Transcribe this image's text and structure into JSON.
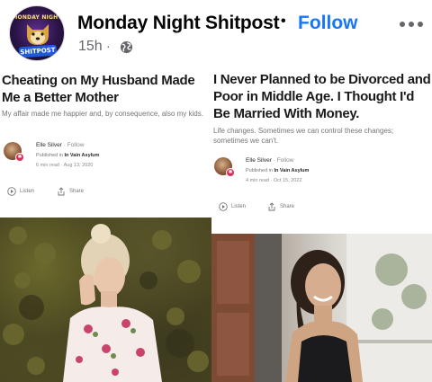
{
  "post": {
    "page_name": "Monday Night Shitpost",
    "separator": "•",
    "follow_label": "Follow",
    "time": "15h",
    "time_separator": "·",
    "privacy_icon": "globe-icon",
    "more_icon": "more-dots-icon"
  },
  "page_avatar": {
    "top_text": "MONDAY NIGHT",
    "badge_text": "SHITPOST",
    "accent": "#1f59d6"
  },
  "articles": [
    {
      "title": "Cheating on My Husband Made Me a Better Mother",
      "subtitle": "My affair made me happier and, by consequence, also my kids.",
      "author": "Elle Silver",
      "author_follow": "Follow",
      "published_prefix": "Published in",
      "publication": "In Vain Asylum",
      "read_time": "6 min read",
      "date": "Aug 13, 2020",
      "listen_label": "Listen",
      "share_label": "Share"
    },
    {
      "title": "I Never Planned to be Divorced and Poor in Middle Age. I Thought I'd Be Married With Money.",
      "subtitle": "Life changes. Sometimes we can control these changes; sometimes we can't.",
      "author": "Elle Silver",
      "author_follow": "Follow",
      "published_prefix": "Published in",
      "publication": "In Vain Asylum",
      "read_time": "4 min read",
      "date": "Oct 15, 2022",
      "listen_label": "Listen",
      "share_label": "Share"
    }
  ],
  "colors": {
    "follow_blue": "#1877f2",
    "meta_gray": "#65676b",
    "medium_badge": "#d6305a"
  }
}
